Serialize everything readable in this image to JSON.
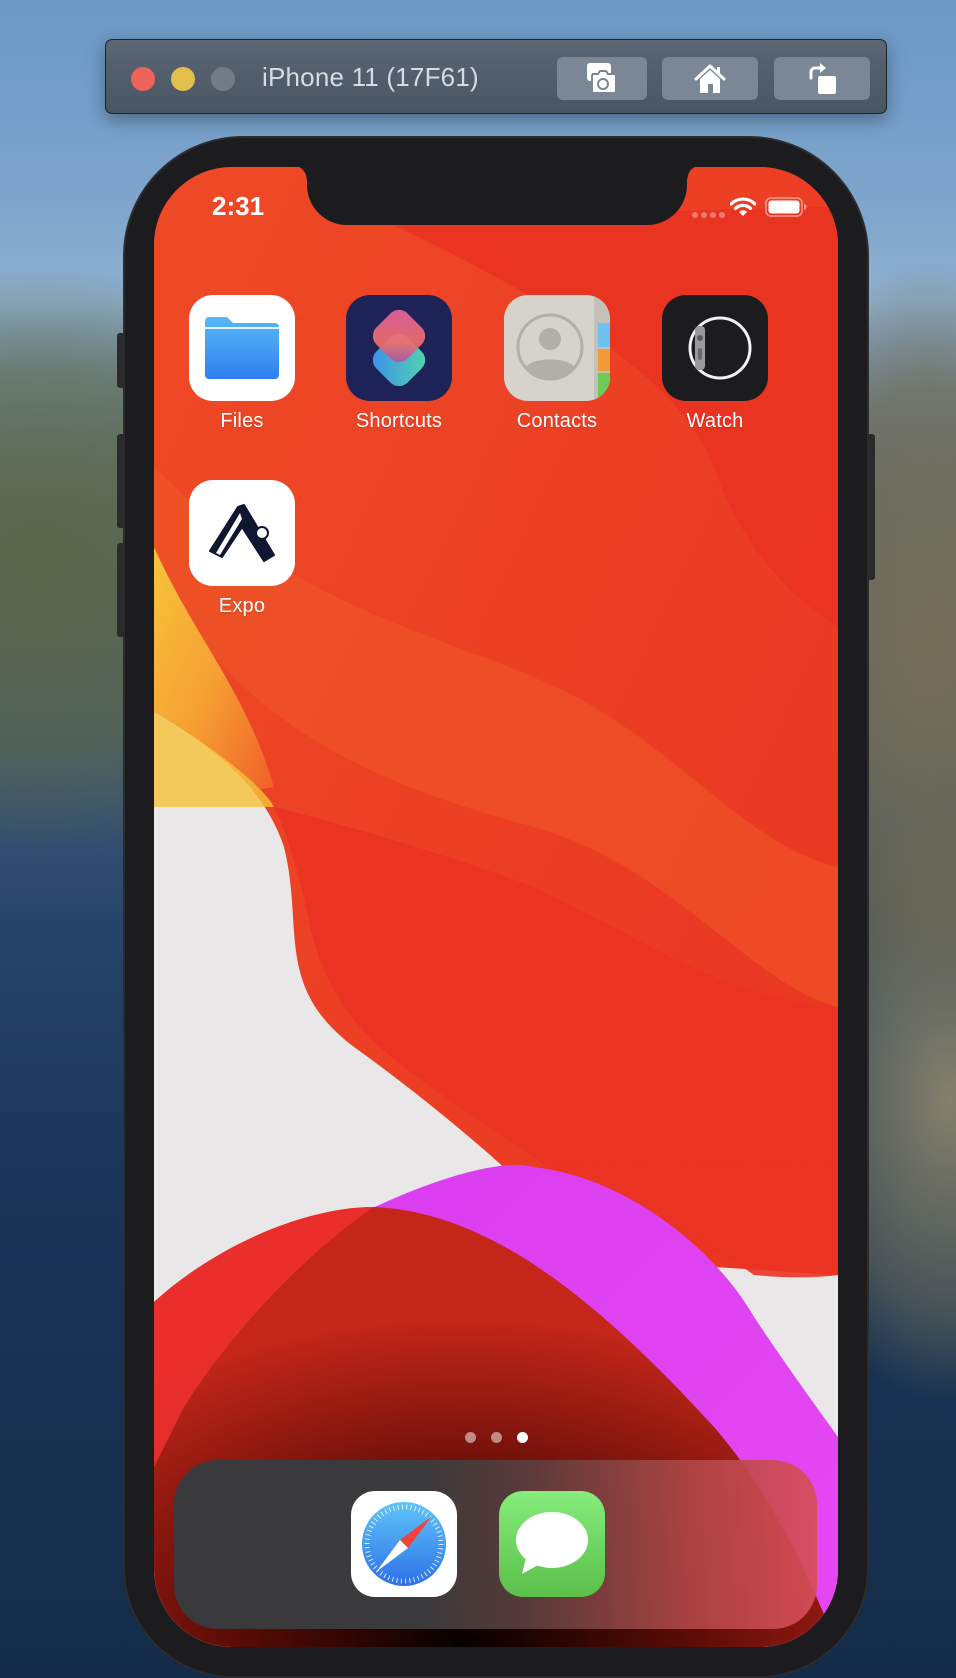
{
  "simulator": {
    "title": "iPhone 11 (17F61)",
    "buttons": [
      {
        "name": "screenshot",
        "icon": "camera-icon"
      },
      {
        "name": "home",
        "icon": "home-icon"
      },
      {
        "name": "rotate",
        "icon": "rotate-icon"
      }
    ],
    "traffic_lights": {
      "close": "#ee6458",
      "minimize": "#e2bf4b",
      "maximize": "#737c86"
    }
  },
  "status_bar": {
    "time": "2:31",
    "wifi_icon": "wifi-icon",
    "battery_icon": "battery-icon",
    "battery_level": 1.0
  },
  "home_screen": {
    "apps": [
      {
        "label": "Files",
        "icon": "files-folder-icon"
      },
      {
        "label": "Shortcuts",
        "icon": "shortcuts-icon"
      },
      {
        "label": "Contacts",
        "icon": "contacts-icon"
      },
      {
        "label": "Watch",
        "icon": "watch-icon"
      },
      {
        "label": "Expo",
        "icon": "expo-icon"
      }
    ],
    "page_indicator": {
      "total": 3,
      "current": 3
    }
  },
  "dock": {
    "apps": [
      {
        "label": "Safari",
        "icon": "safari-compass-icon"
      },
      {
        "label": "Messages",
        "icon": "messages-bubble-icon"
      }
    ]
  }
}
